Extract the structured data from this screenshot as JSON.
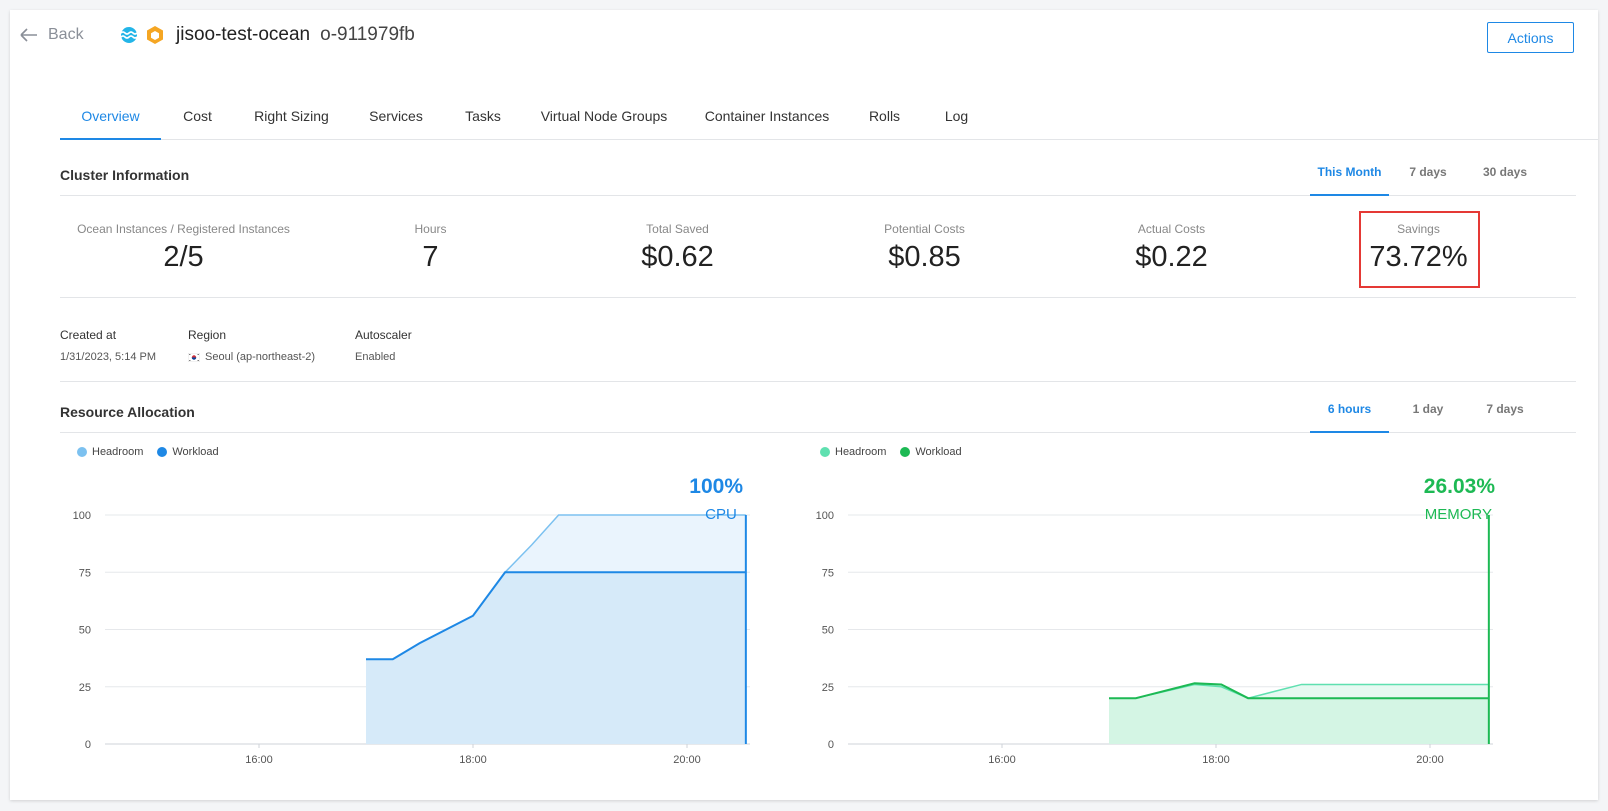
{
  "header": {
    "back_label": "Back",
    "cluster_name": "jisoo-test-ocean",
    "cluster_id": "o-911979fb",
    "actions_label": "Actions"
  },
  "tabs": [
    "Overview",
    "Cost",
    "Right Sizing",
    "Services",
    "Tasks",
    "Virtual Node Groups",
    "Container Instances",
    "Rolls",
    "Log"
  ],
  "cluster_info": {
    "title": "Cluster Information",
    "periods": [
      "This Month",
      "7 days",
      "30 days"
    ],
    "stats": [
      {
        "label": "Ocean Instances / Registered Instances",
        "value": "2/5"
      },
      {
        "label": "Hours",
        "value": "7"
      },
      {
        "label": "Total Saved",
        "value": "$0.62"
      },
      {
        "label": "Potential Costs",
        "value": "$0.85"
      },
      {
        "label": "Actual Costs",
        "value": "$0.22"
      },
      {
        "label": "Savings",
        "value": "73.72%"
      }
    ],
    "created_label": "Created at",
    "created_value": "1/31/2023, 5:14 PM",
    "region_label": "Region",
    "region_value": "Seoul (ap-northeast-2)",
    "autoscaler_label": "Autoscaler",
    "autoscaler_value": "Enabled"
  },
  "resource_allocation": {
    "title": "Resource Allocation",
    "periods": [
      "6 hours",
      "1 day",
      "7 days"
    ],
    "legend_headroom": "Headroom",
    "legend_workload": "Workload"
  },
  "colors": {
    "accent": "#1e88e5",
    "cpu_line": "#1e88e5",
    "cpu_headroom": "#7cc1f0",
    "mem_line": "#1db954",
    "mem_headroom": "#5fe0b0",
    "highlight": "#e53935"
  },
  "chart_data": [
    {
      "type": "area",
      "name": "CPU",
      "current_value": "100%",
      "current_label": "CPU",
      "x_ticks": [
        "16:00",
        "18:00",
        "20:00"
      ],
      "x": [
        17.0,
        17.25,
        17.5,
        18.0,
        18.3,
        18.55,
        18.8,
        20.55
      ],
      "ylim": [
        0,
        100
      ],
      "y_ticks": [
        0,
        25,
        50,
        75,
        100
      ],
      "series": [
        {
          "name": "Headroom",
          "values": [
            37,
            37,
            44,
            56,
            75,
            87,
            100,
            100
          ]
        },
        {
          "name": "Workload",
          "values": [
            37,
            37,
            44,
            56,
            75,
            75,
            75,
            75
          ]
        }
      ]
    },
    {
      "type": "area",
      "name": "MEMORY",
      "current_value": "26.03%",
      "current_label": "MEMORY",
      "x_ticks": [
        "16:00",
        "18:00",
        "20:00"
      ],
      "x": [
        17.0,
        17.25,
        17.8,
        18.05,
        18.3,
        18.8,
        20.55
      ],
      "ylim": [
        0,
        100
      ],
      "y_ticks": [
        0,
        25,
        50,
        75,
        100
      ],
      "series": [
        {
          "name": "Headroom",
          "values": [
            20,
            20,
            26,
            25,
            20,
            26,
            26
          ]
        },
        {
          "name": "Workload",
          "values": [
            20,
            20,
            26.5,
            26,
            20,
            20,
            20
          ]
        }
      ]
    }
  ]
}
